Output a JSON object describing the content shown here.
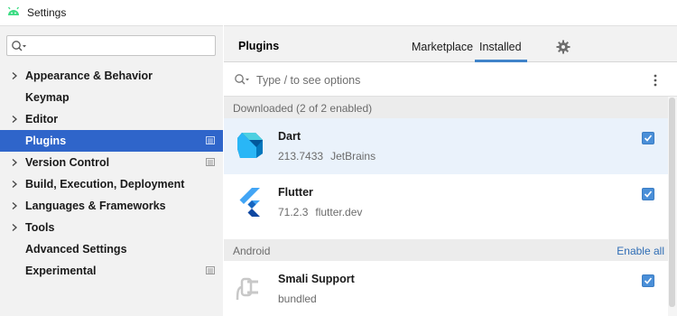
{
  "window": {
    "title": "Settings"
  },
  "sidebar": {
    "search": {
      "value": "",
      "placeholder": ""
    },
    "items": [
      {
        "label": "Appearance & Behavior",
        "expandable": true
      },
      {
        "label": "Keymap",
        "expandable": false
      },
      {
        "label": "Editor",
        "expandable": true
      },
      {
        "label": "Plugins",
        "expandable": false,
        "selected": true
      },
      {
        "label": "Version Control",
        "expandable": true
      },
      {
        "label": "Build, Execution, Deployment",
        "expandable": true
      },
      {
        "label": "Languages & Frameworks",
        "expandable": true
      },
      {
        "label": "Tools",
        "expandable": true
      },
      {
        "label": "Advanced Settings",
        "expandable": false
      },
      {
        "label": "Experimental",
        "expandable": false
      }
    ]
  },
  "header": {
    "title": "Plugins",
    "tabs": [
      {
        "label": "Marketplace",
        "active": false
      },
      {
        "label": "Installed",
        "active": true
      }
    ]
  },
  "filter": {
    "placeholder": "Type / to see options"
  },
  "groups": [
    {
      "label": "Downloaded (2 of 2 enabled)",
      "action": "",
      "plugins": [
        {
          "name": "Dart",
          "version": "213.7433",
          "vendor": "JetBrains",
          "enabled": true,
          "icon": "dart-logo-icon"
        },
        {
          "name": "Flutter",
          "version": "71.2.3",
          "vendor": "flutter.dev",
          "enabled": true,
          "icon": "flutter-logo-icon"
        }
      ]
    },
    {
      "label": "Android",
      "action": "Enable all",
      "plugins": [
        {
          "name": "Smali Support",
          "version": "bundled",
          "vendor": "",
          "enabled": true,
          "icon": "plug-icon"
        }
      ]
    }
  ],
  "colors": {
    "selection": "#2f65ca",
    "accent": "#4083c9",
    "checkbox": "#4a8fd8",
    "link": "#2f6db5",
    "row_hover": "#eaf2fb"
  }
}
